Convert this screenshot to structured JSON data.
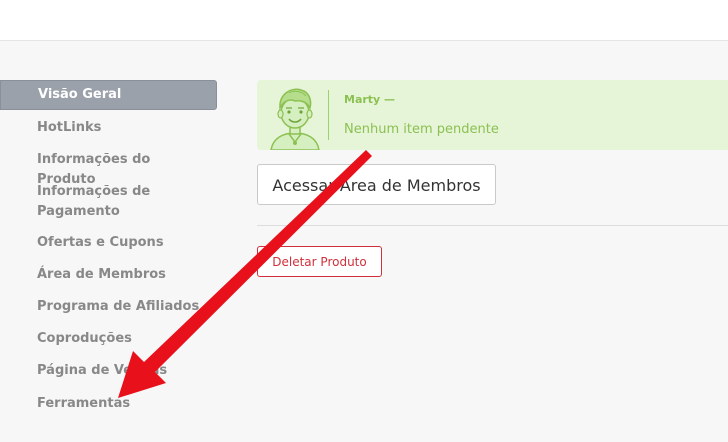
{
  "sidebar": {
    "items": [
      {
        "label": "Visão Geral",
        "active": true
      },
      {
        "label": "HotLinks"
      },
      {
        "label": "Informações do Produto"
      },
      {
        "label": "Informações de Pagamento"
      },
      {
        "label": "Ofertas e Cupons"
      },
      {
        "label": "Área de Membros"
      },
      {
        "label": "Programa de Afiliados"
      },
      {
        "label": "Coproduções"
      },
      {
        "label": "Página de Vendas"
      },
      {
        "label": "Ferramentas"
      }
    ]
  },
  "pending": {
    "author": "Marty —",
    "message": "Nenhum item pendente"
  },
  "actions": {
    "members_area_label": "Acessar Área de Membros",
    "delete_label": "Deletar Produto"
  },
  "annotation": {
    "arrow_color": "#e8101a"
  },
  "colors": {
    "sidebar_active": "#9aa1ab",
    "success_bg": "#e6f4d8",
    "success_text": "#8cc152",
    "danger": "#d0303c"
  }
}
